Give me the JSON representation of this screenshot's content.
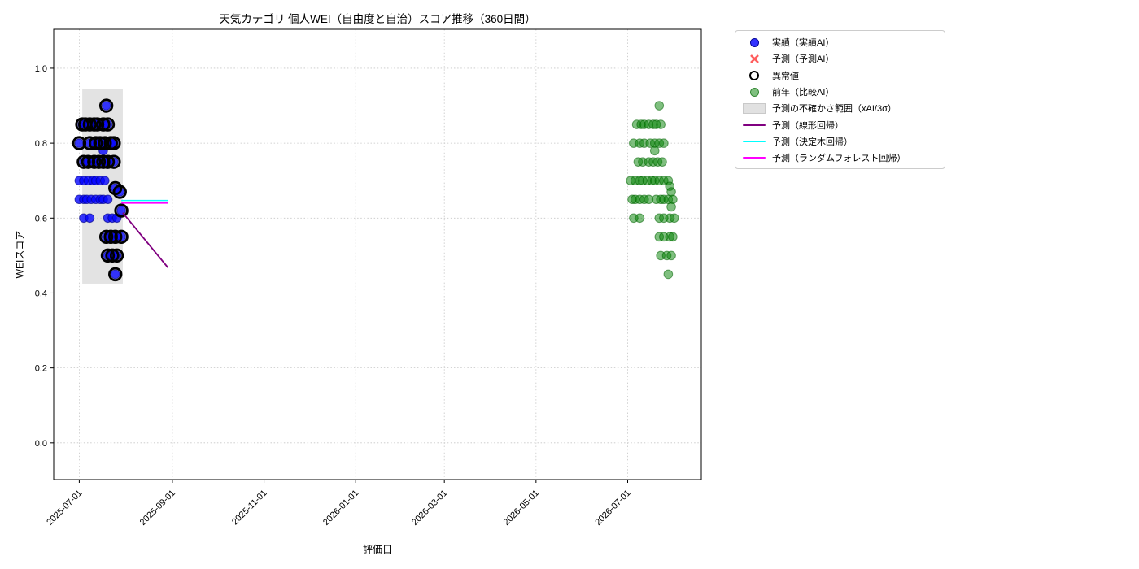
{
  "chart": {
    "title": "天気カテゴリ 個人WEI（自由度と自治）スコア推移（360日間）",
    "xlabel": "評価日",
    "ylabel": "WEIスコア"
  },
  "legend": {
    "items": [
      {
        "label": "実績（実績AI）",
        "marker": "blue-dot",
        "color": "#0000ff"
      },
      {
        "label": "予測（予測AI）",
        "marker": "red-x",
        "color": "#e85050"
      },
      {
        "label": "異常値",
        "marker": "open-circle",
        "color": "#000000"
      },
      {
        "label": "前年（比較AI）",
        "marker": "green-dot",
        "color": "#008000"
      },
      {
        "label": "予測の不確かさ範囲（xAI/3σ）",
        "marker": "gray-band",
        "color": "#dcdcdc"
      },
      {
        "label": "予測（線形回帰）",
        "marker": "line",
        "color": "#800080"
      },
      {
        "label": "予測（決定木回帰）",
        "marker": "line",
        "color": "#00ffff"
      },
      {
        "label": "予測（ランダムフォレスト回帰）",
        "marker": "line",
        "color": "#ff00ff"
      }
    ]
  },
  "chart_data": {
    "type": "scatter",
    "title": "天気カテゴリ 個人WEI（自由度と自治）スコア推移（360日間）",
    "xlabel": "評価日",
    "ylabel": "WEIスコア",
    "grid": true,
    "x_epoch": "2025-07-01",
    "x_domain_days": [
      -17,
      414
    ],
    "x_tick_labels": [
      "2025-07-01",
      "2025-09-01",
      "2025-11-01",
      "2026-01-01",
      "2026-03-01",
      "2026-05-01",
      "2026-07-01"
    ],
    "y_ticks": [
      0.0,
      0.2,
      0.4,
      0.6,
      0.8,
      1.0
    ],
    "ylim": [
      -0.098,
      1.104
    ],
    "legend_position": "outside-top-right",
    "uncertainty_band": {
      "name": "予測の不確かさ範囲（xAI/3σ）",
      "color": "rgba(200,200,200,0.5)",
      "x0": "2025-07-03",
      "x1": "2025-07-30",
      "y0": 0.425,
      "y1": 0.944
    },
    "series": [
      {
        "name": "実績（実績AI）",
        "color": "rgba(0,0,255,0.78)",
        "edge": "rgba(0,0,140,0.65)",
        "outlier_ring_color": "#000000",
        "points": [
          [
            "2025-07-19",
            0.9,
            1
          ],
          [
            "2025-07-03",
            0.85,
            1
          ],
          [
            "2025-07-05",
            0.85,
            1
          ],
          [
            "2025-07-08",
            0.85,
            1
          ],
          [
            "2025-07-11",
            0.85,
            1
          ],
          [
            "2025-07-13",
            0.85,
            1
          ],
          [
            "2025-07-17",
            0.85,
            1
          ],
          [
            "2025-07-20",
            0.85,
            1
          ],
          [
            "2025-07-01",
            0.8,
            1
          ],
          [
            "2025-07-08",
            0.8,
            1
          ],
          [
            "2025-07-12",
            0.8,
            1
          ],
          [
            "2025-07-15",
            0.8,
            1
          ],
          [
            "2025-07-18",
            0.8,
            1
          ],
          [
            "2025-07-22",
            0.8,
            1
          ],
          [
            "2025-07-24",
            0.8,
            1
          ],
          [
            "2025-07-17",
            0.78,
            0
          ],
          [
            "2025-07-04",
            0.75,
            1
          ],
          [
            "2025-07-07",
            0.75,
            1
          ],
          [
            "2025-07-11",
            0.75,
            1
          ],
          [
            "2025-07-14",
            0.75,
            1
          ],
          [
            "2025-07-17",
            0.75,
            1
          ],
          [
            "2025-07-20",
            0.75,
            1
          ],
          [
            "2025-07-24",
            0.75,
            1
          ],
          [
            "2025-07-01",
            0.7,
            0
          ],
          [
            "2025-07-04",
            0.7,
            0
          ],
          [
            "2025-07-07",
            0.7,
            0
          ],
          [
            "2025-07-10",
            0.7,
            0
          ],
          [
            "2025-07-12",
            0.7,
            0
          ],
          [
            "2025-07-15",
            0.7,
            0
          ],
          [
            "2025-07-18",
            0.7,
            0
          ],
          [
            "2025-07-25",
            0.68,
            1
          ],
          [
            "2025-07-28",
            0.67,
            1
          ],
          [
            "2025-07-01",
            0.65,
            0
          ],
          [
            "2025-07-04",
            0.65,
            0
          ],
          [
            "2025-07-06",
            0.65,
            0
          ],
          [
            "2025-07-09",
            0.65,
            0
          ],
          [
            "2025-07-12",
            0.65,
            0
          ],
          [
            "2025-07-15",
            0.65,
            0
          ],
          [
            "2025-07-17",
            0.65,
            0
          ],
          [
            "2025-07-20",
            0.65,
            0
          ],
          [
            "2025-07-29",
            0.62,
            1
          ],
          [
            "2025-07-04",
            0.6,
            0
          ],
          [
            "2025-07-08",
            0.6,
            0
          ],
          [
            "2025-07-20",
            0.6,
            0
          ],
          [
            "2025-07-23",
            0.6,
            0
          ],
          [
            "2025-07-26",
            0.6,
            0
          ],
          [
            "2025-07-19",
            0.55,
            1
          ],
          [
            "2025-07-22",
            0.55,
            1
          ],
          [
            "2025-07-25",
            0.55,
            1
          ],
          [
            "2025-07-29",
            0.55,
            1
          ],
          [
            "2025-07-20",
            0.5,
            1
          ],
          [
            "2025-07-23",
            0.5,
            1
          ],
          [
            "2025-07-26",
            0.5,
            1
          ],
          [
            "2025-07-25",
            0.45,
            1
          ]
        ]
      },
      {
        "name": "前年（比較AI）",
        "color": "rgba(0,128,0,0.5)",
        "edge": "rgba(0,100,0,0.55)",
        "points": [
          [
            "2026-07-22",
            0.9,
            0
          ],
          [
            "2026-07-07",
            0.85,
            0
          ],
          [
            "2026-07-10",
            0.85,
            0
          ],
          [
            "2026-07-12",
            0.85,
            0
          ],
          [
            "2026-07-15",
            0.85,
            0
          ],
          [
            "2026-07-18",
            0.85,
            0
          ],
          [
            "2026-07-20",
            0.85,
            0
          ],
          [
            "2026-07-23",
            0.85,
            0
          ],
          [
            "2026-07-05",
            0.8,
            0
          ],
          [
            "2026-07-09",
            0.8,
            0
          ],
          [
            "2026-07-12",
            0.8,
            0
          ],
          [
            "2026-07-16",
            0.8,
            0
          ],
          [
            "2026-07-19",
            0.8,
            0
          ],
          [
            "2026-07-22",
            0.8,
            0
          ],
          [
            "2026-07-25",
            0.8,
            0
          ],
          [
            "2026-07-19",
            0.78,
            0
          ],
          [
            "2026-07-08",
            0.75,
            0
          ],
          [
            "2026-07-11",
            0.75,
            0
          ],
          [
            "2026-07-15",
            0.75,
            0
          ],
          [
            "2026-07-18",
            0.75,
            0
          ],
          [
            "2026-07-21",
            0.75,
            0
          ],
          [
            "2026-07-24",
            0.75,
            0
          ],
          [
            "2026-07-03",
            0.7,
            0
          ],
          [
            "2026-07-06",
            0.7,
            0
          ],
          [
            "2026-07-09",
            0.7,
            0
          ],
          [
            "2026-07-11",
            0.7,
            0
          ],
          [
            "2026-07-14",
            0.7,
            0
          ],
          [
            "2026-07-17",
            0.7,
            0
          ],
          [
            "2026-07-19",
            0.7,
            0
          ],
          [
            "2026-07-22",
            0.7,
            0
          ],
          [
            "2026-07-25",
            0.7,
            0
          ],
          [
            "2026-07-28",
            0.7,
            0
          ],
          [
            "2026-07-29",
            0.685,
            0
          ],
          [
            "2026-07-30",
            0.67,
            0
          ],
          [
            "2026-07-04",
            0.65,
            0
          ],
          [
            "2026-07-06",
            0.65,
            0
          ],
          [
            "2026-07-09",
            0.65,
            0
          ],
          [
            "2026-07-12",
            0.65,
            0
          ],
          [
            "2026-07-15",
            0.65,
            0
          ],
          [
            "2026-07-20",
            0.65,
            0
          ],
          [
            "2026-07-23",
            0.65,
            0
          ],
          [
            "2026-07-25",
            0.65,
            0
          ],
          [
            "2026-07-28",
            0.65,
            0
          ],
          [
            "2026-07-31",
            0.65,
            0
          ],
          [
            "2026-07-30",
            0.63,
            0
          ],
          [
            "2026-07-05",
            0.6,
            0
          ],
          [
            "2026-07-09",
            0.6,
            0
          ],
          [
            "2026-07-22",
            0.6,
            0
          ],
          [
            "2026-07-25",
            0.6,
            0
          ],
          [
            "2026-07-29",
            0.6,
            0
          ],
          [
            "2026-08-01",
            0.6,
            0
          ],
          [
            "2026-07-22",
            0.55,
            0
          ],
          [
            "2026-07-25",
            0.55,
            0
          ],
          [
            "2026-07-29",
            0.55,
            0
          ],
          [
            "2026-07-31",
            0.55,
            0
          ],
          [
            "2026-07-23",
            0.5,
            0
          ],
          [
            "2026-07-27",
            0.5,
            0
          ],
          [
            "2026-07-30",
            0.5,
            0
          ],
          [
            "2026-07-28",
            0.45,
            0
          ]
        ]
      }
    ],
    "forecast_lines": [
      {
        "name": "予測（決定木回帰）",
        "color": "#00ffff",
        "width": 1.6,
        "points": [
          [
            "2025-07-29",
            0.647
          ],
          [
            "2025-08-29",
            0.647
          ]
        ]
      },
      {
        "name": "予測（ランダムフォレスト回帰）",
        "color": "#ff00ff",
        "width": 1.6,
        "points": [
          [
            "2025-07-29",
            0.64
          ],
          [
            "2025-08-29",
            0.64
          ]
        ]
      },
      {
        "name": "予測（線形回帰）",
        "color": "#800080",
        "width": 1.8,
        "points": [
          [
            "2025-07-30",
            0.614
          ],
          [
            "2025-08-29",
            0.468
          ]
        ]
      }
    ]
  }
}
